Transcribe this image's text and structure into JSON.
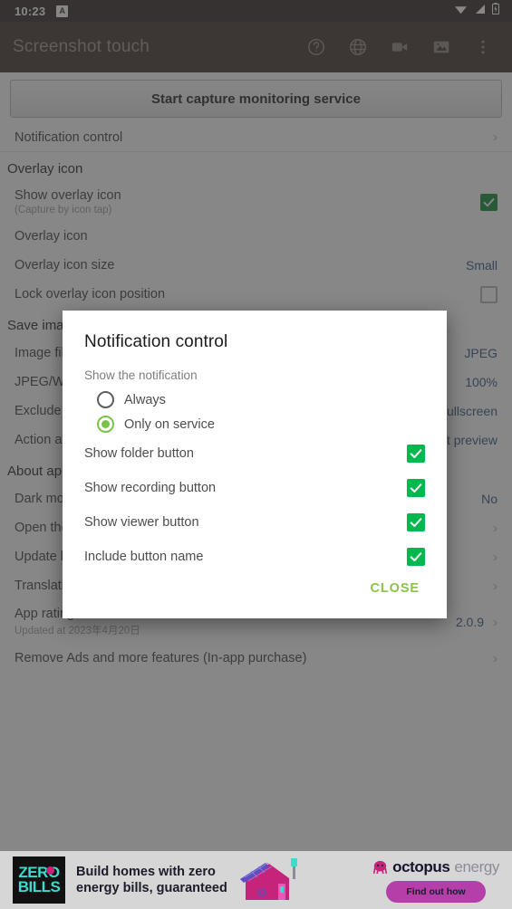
{
  "status_bar": {
    "time": "10:23",
    "notification_badge": "A",
    "icons": [
      "wifi-icon",
      "cellular-signal-icon",
      "battery-icon"
    ]
  },
  "app_bar": {
    "title": "Screenshot touch",
    "actions": [
      {
        "name": "help-icon",
        "label": "Help"
      },
      {
        "name": "globe-icon",
        "label": "Language"
      },
      {
        "name": "video-camera-icon",
        "label": "Record"
      },
      {
        "name": "image-icon",
        "label": "Gallery"
      },
      {
        "name": "overflow-menu-icon",
        "label": "More options"
      }
    ]
  },
  "settings": {
    "start_button": "Start capture monitoring service",
    "notification_control_row": "Notification control",
    "sections": [
      {
        "header": "Overlay icon",
        "rows": [
          {
            "title": "Show overlay icon",
            "sub": "(Capture by icon tap)",
            "control": "checkbox",
            "checked": true
          },
          {
            "title": "Overlay icon",
            "sub": "",
            "control": "none"
          },
          {
            "title": "Overlay icon size",
            "sub": "",
            "control": "value",
            "value": "Small"
          },
          {
            "title": "Lock overlay icon position",
            "sub": "",
            "control": "checkbox",
            "checked": false
          }
        ]
      },
      {
        "header": "Save image",
        "rows": [
          {
            "title": "Image file format",
            "sub": "",
            "control": "value",
            "value": "JPEG"
          },
          {
            "title": "JPEG/WEBP quality",
            "sub": "",
            "control": "value",
            "value": "100%"
          },
          {
            "title": "Exclude status bar",
            "sub": "",
            "control": "value",
            "value": "Fullscreen"
          },
          {
            "title": "Action after capture",
            "sub": "",
            "control": "value",
            "value": "Post preview"
          }
        ]
      },
      {
        "header": "About app",
        "rows": [
          {
            "title": "Dark mode",
            "sub": "",
            "control": "value",
            "value": "No"
          },
          {
            "title": "Open the app store page",
            "sub": "",
            "control": "chevron"
          },
          {
            "title": "Update history",
            "sub": "",
            "control": "chevron"
          },
          {
            "title": "Translation help",
            "sub": "",
            "control": "chevron"
          },
          {
            "title": "App rating",
            "sub": "Updated at 2023年4月20日",
            "control": "value-chevron",
            "value": "2.0.9"
          },
          {
            "title": "Remove Ads and more features (In-app purchase)",
            "sub": "",
            "control": "chevron"
          }
        ]
      }
    ]
  },
  "dialog": {
    "title": "Notification control",
    "group_label": "Show the notification",
    "radios": [
      {
        "label": "Always",
        "selected": false
      },
      {
        "label": "Only on service",
        "selected": true
      }
    ],
    "checkboxes": [
      {
        "label": "Show folder button",
        "checked": true
      },
      {
        "label": "Show recording button",
        "checked": true
      },
      {
        "label": "Show viewer button",
        "checked": true
      },
      {
        "label": "Include button name",
        "checked": true
      }
    ],
    "close_label": "CLOSE",
    "accent_color": "#8bc34a",
    "checkbox_color": "#00b84d"
  },
  "ad": {
    "logo_line1": "ZERO",
    "logo_line2": "BILLS",
    "headline_line1": "Build homes with zero",
    "headline_line2": "energy bills, guaranteed",
    "brand_bold": "octopus",
    "brand_light": "energy",
    "cta": "Find out how"
  }
}
